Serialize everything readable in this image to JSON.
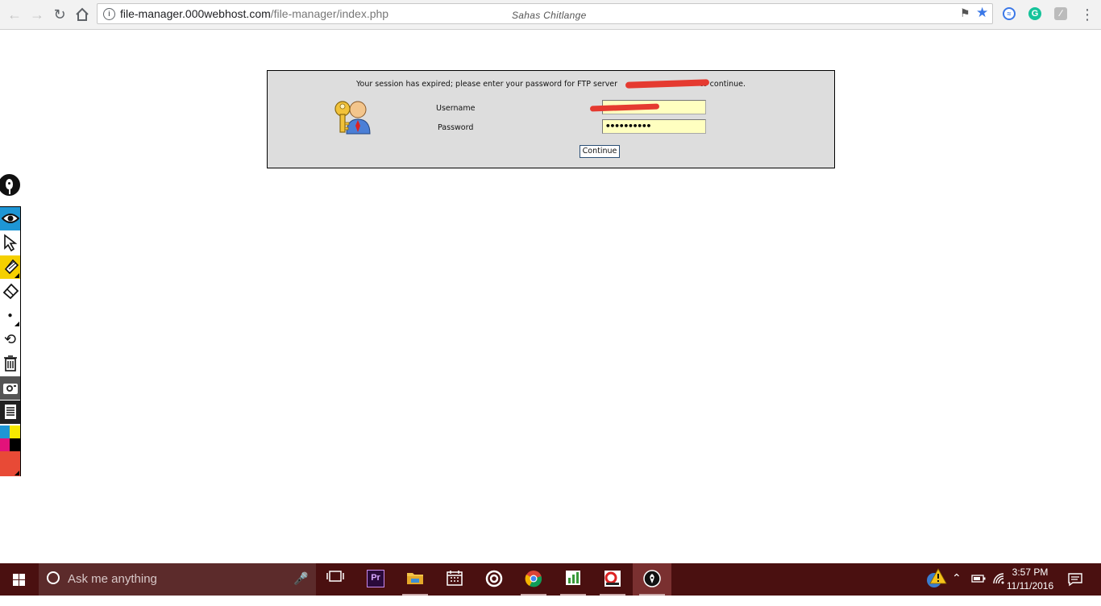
{
  "browser": {
    "url_host": "file-manager.000webhost.com",
    "url_path": "/file-manager/index.php",
    "profile_name": "Sahas Chitlange"
  },
  "session": {
    "message_prefix": "Your session has expired; please enter your password for FTP server",
    "message_suffix": "to continue.",
    "username_label": "Username",
    "password_label": "Password",
    "username_value": "",
    "password_value": "••••••••••",
    "continue_label": "Continue"
  },
  "taskbar": {
    "search_placeholder": "Ask me anything",
    "clock_time": "3:57 PM",
    "clock_date": "11/11/2016"
  },
  "colors": {
    "taskbar_bg": "#4a1010",
    "dialog_bg": "#dddddd",
    "input_bg": "#ffffc0",
    "redaction": "#e53a30",
    "highlighter": "#f5d000",
    "eye_tool": "#1e96d5",
    "bookmark_star": "#3b78e7"
  },
  "icons": {
    "toolbar": [
      "back-icon",
      "forward-icon",
      "reload-icon",
      "home-icon",
      "info-icon",
      "pin-icon",
      "star-icon",
      "extension-icon",
      "grammarly-icon",
      "extension-icon",
      "menu-icon"
    ],
    "draw_tools": [
      "pen-logo-icon",
      "eye-icon",
      "pointer-icon",
      "highlighter-icon",
      "eraser-icon",
      "dot-icon",
      "undo-icon",
      "trash-icon",
      "camera-icon",
      "notes-icon",
      "palette-icon",
      "color-icon"
    ],
    "taskbar": [
      "windows-icon",
      "cortana-icon",
      "mic-icon",
      "task-view-icon",
      "premiere-icon",
      "file-explorer-icon",
      "calendar-icon",
      "target-icon",
      "chrome-icon",
      "chart-app-icon",
      "cs-app-icon",
      "pen-app-icon",
      "warning-icon",
      "chevron-up-icon",
      "battery-icon",
      "wifi-icon",
      "notification-icon"
    ]
  }
}
